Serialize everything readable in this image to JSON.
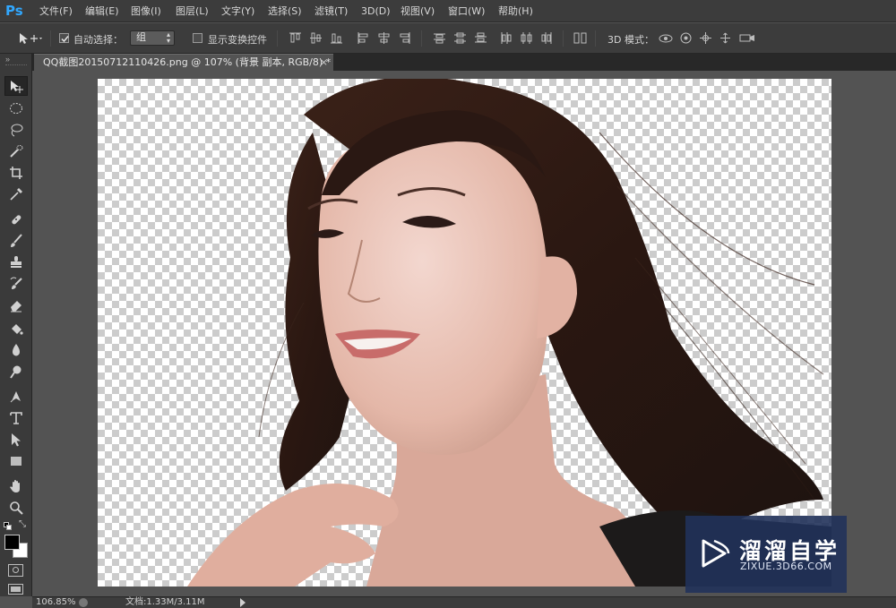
{
  "app": {
    "logo": "Ps"
  },
  "menu": {
    "items": [
      "文件(F)",
      "编辑(E)",
      "图像(I)",
      "图层(L)",
      "文字(Y)",
      "选择(S)",
      "滤镜(T)",
      "3D(D)",
      "视图(V)",
      "窗口(W)",
      "帮助(H)"
    ]
  },
  "options": {
    "auto_select_label": "自动选择：",
    "auto_select_checked": true,
    "auto_select_value": "组",
    "show_transform_label": "显示变换控件",
    "show_transform_checked": false,
    "mode_3d_label": "3D 模式："
  },
  "document": {
    "tab_title": "QQ截图20150712110426.png @ 107% (背景 副本, RGB/8) *",
    "close_glyph": "×"
  },
  "tools": [
    "move-tool",
    "marquee-tool",
    "lasso-tool",
    "quick-select-tool",
    "crop-tool",
    "eyedropper-tool",
    "healing-brush-tool",
    "brush-tool",
    "clone-stamp-tool",
    "history-brush-tool",
    "eraser-tool",
    "paint-bucket-tool",
    "blur-tool",
    "dodge-tool",
    "pen-tool",
    "type-tool",
    "path-selection-tool",
    "rectangle-tool",
    "hand-tool",
    "zoom-tool"
  ],
  "colors": {
    "foreground": "#000000",
    "background": "#ffffff",
    "ui_dark": "#3c3c3c",
    "workspace": "#535353",
    "accent": "#31a8ff"
  },
  "status": {
    "zoom": "106.85%",
    "doc_info": "文档:1.33M/3.11M"
  },
  "watermark": {
    "title": "溜溜自学",
    "url": "ZIXUE.3D66.COM"
  }
}
